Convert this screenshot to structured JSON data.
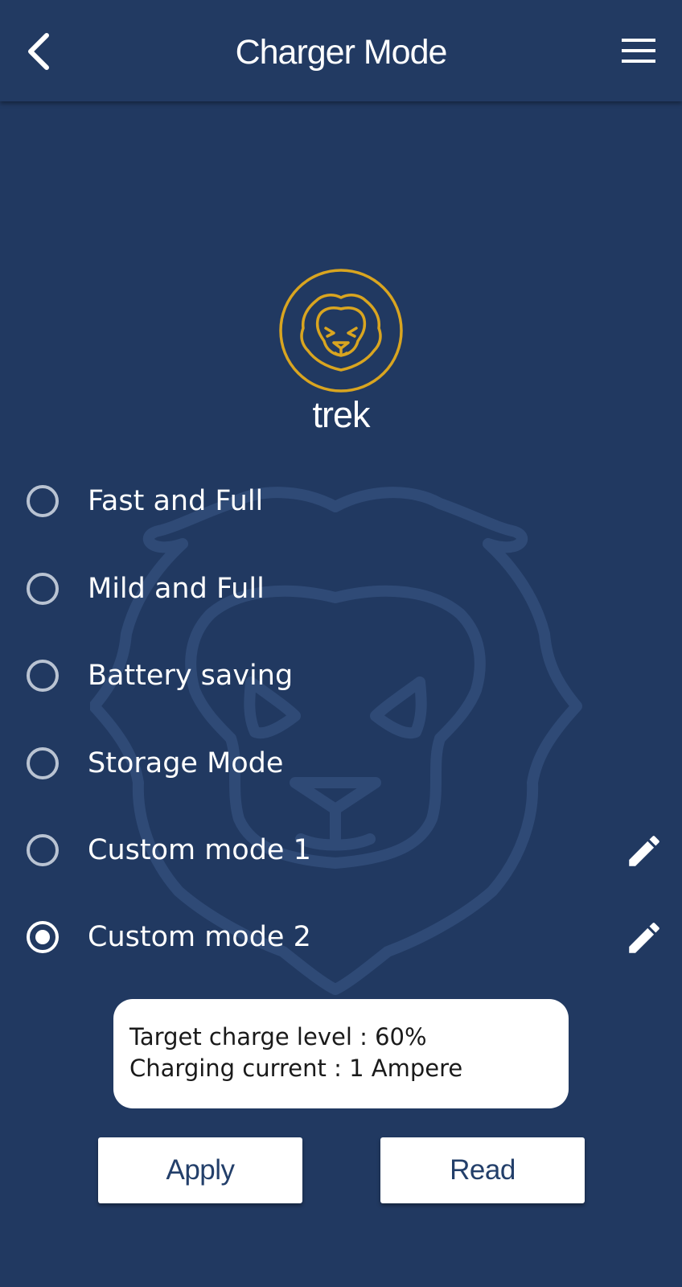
{
  "header": {
    "title": "Charger Mode",
    "back_icon": "chevron-left-icon",
    "menu_icon": "hamburger-menu-icon"
  },
  "brand": {
    "name": "trek",
    "logo_icon": "lion-logo-icon",
    "accent_color": "#D9A520"
  },
  "modes": [
    {
      "label": "Fast and Full",
      "selected": false,
      "editable": false
    },
    {
      "label": "Mild and Full",
      "selected": false,
      "editable": false
    },
    {
      "label": "Battery saving",
      "selected": false,
      "editable": false
    },
    {
      "label": "Storage Mode",
      "selected": false,
      "editable": false
    },
    {
      "label": "Custom mode 1",
      "selected": false,
      "editable": true
    },
    {
      "label": "Custom mode 2",
      "selected": true,
      "editable": true
    }
  ],
  "info": {
    "line1": "Target charge level : 60%",
    "line2": "Charging current : 1 Ampere"
  },
  "actions": {
    "apply_label": "Apply",
    "read_label": "Read"
  },
  "colors": {
    "background": "#213961",
    "header": "#223A62"
  }
}
